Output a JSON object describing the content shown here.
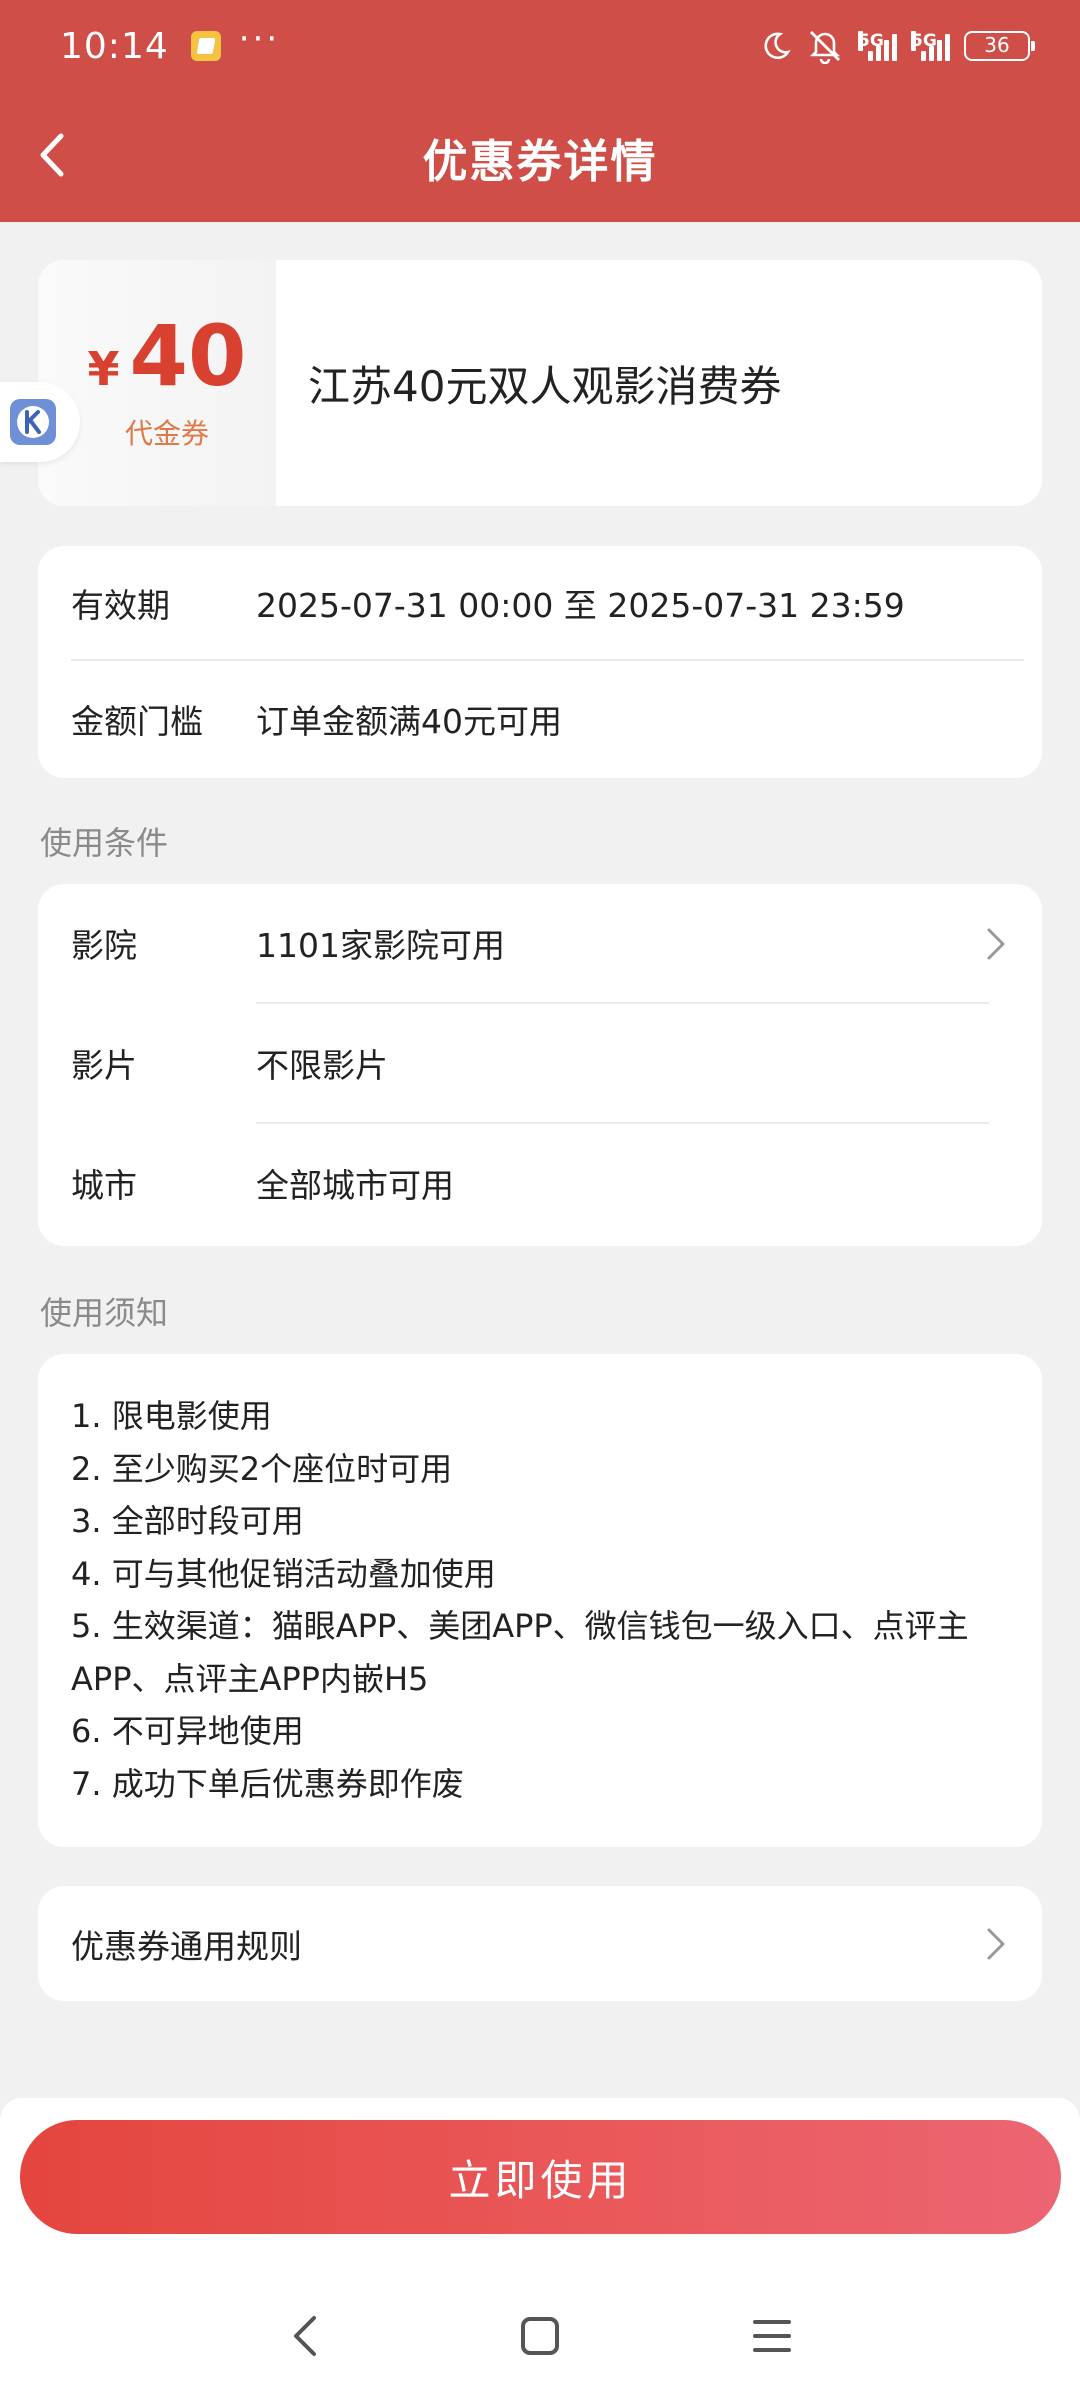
{
  "status_bar": {
    "time": "10:14",
    "more": "···",
    "battery": "36",
    "signal_label_1": "5G",
    "signal_label_2": "5G"
  },
  "header": {
    "title": "优惠券详情"
  },
  "coupon": {
    "currency": "¥",
    "amount": "40",
    "type": "代金券",
    "name": "江苏40元双人观影消费券"
  },
  "info": {
    "validity_label": "有效期",
    "validity_value": "2025-07-31 00:00 至 2025-07-31 23:59",
    "threshold_label": "金额门槛",
    "threshold_value": "订单金额满40元可用"
  },
  "conditions": {
    "section_title": "使用条件",
    "rows": [
      {
        "label": "影院",
        "value": "1101家影院可用"
      },
      {
        "label": "影片",
        "value": "不限影片"
      },
      {
        "label": "城市",
        "value": "全部城市可用"
      }
    ]
  },
  "notice": {
    "section_title": "使用须知",
    "items": [
      "1.  限电影使用",
      "2.  至少购买2个座位时可用",
      "3.  全部时段可用",
      "4.  可与其他促销活动叠加使用",
      "5.  生效渠道：猫眼APP、美团APP、微信钱包一级入口、点评主APP、点评主APP内嵌H5",
      "6.  不可异地使用",
      "7.  成功下单后优惠券即作废"
    ]
  },
  "rules": {
    "label": "优惠券通用规则"
  },
  "action": {
    "use_label": "立即使用"
  },
  "colors": {
    "header_bg": "#cf4e47",
    "accent_red": "#d8402f",
    "coupon_type_orange": "#e0794a",
    "button_start": "#e4453e",
    "button_end": "#ec6572"
  }
}
